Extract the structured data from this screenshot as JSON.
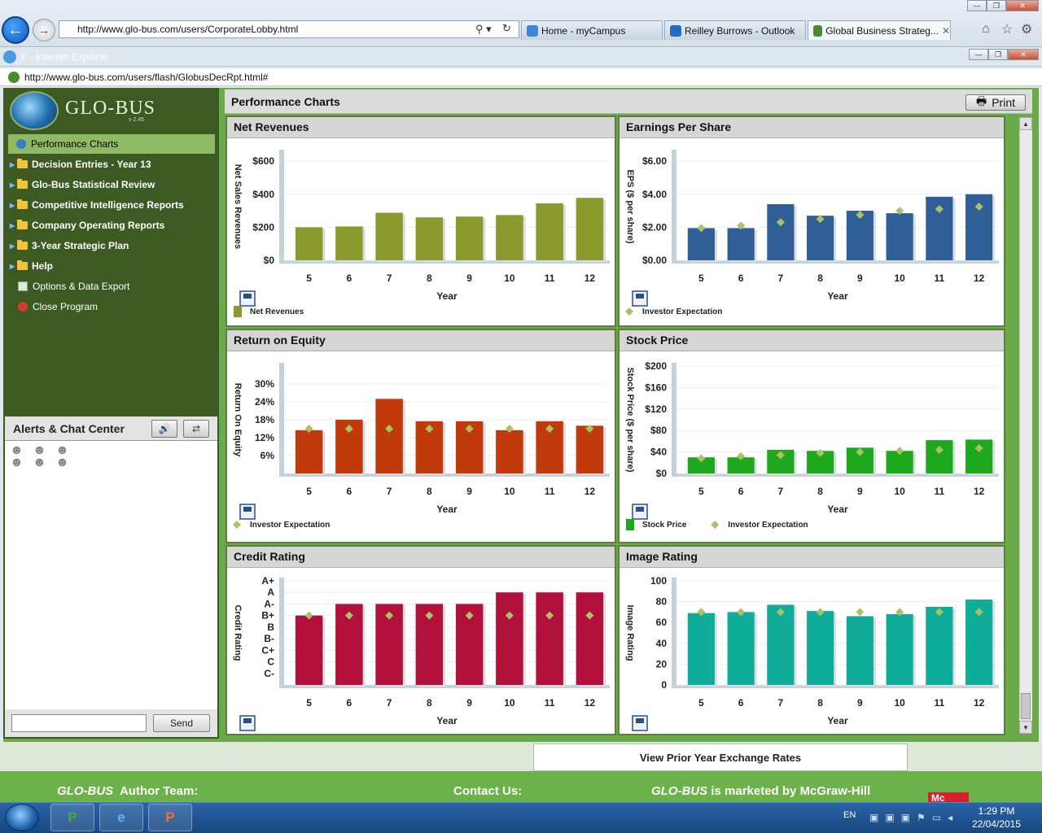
{
  "browser": {
    "address": "http://www.glo-bus.com/users/CorporateLobby.html",
    "tabs": [
      {
        "label": "Home - myCampus"
      },
      {
        "label": "Reilley Burrows - Outlook"
      },
      {
        "label": "Global Business Strateg..."
      }
    ],
    "inner_title": "F - Internet Explorer",
    "inner_address": "http://www.glo-bus.com/users/flash/GlobusDecRpt.html#"
  },
  "app": {
    "logo": "GLO-BUS",
    "version": "v 2.45",
    "menu": [
      {
        "label": "Performance Charts",
        "selected": true
      },
      {
        "label": "Decision Entries - Year 13"
      },
      {
        "label": "Glo-Bus Statistical Review"
      },
      {
        "label": "Competitive Intelligence Reports"
      },
      {
        "label": "Company Operating Reports"
      },
      {
        "label": "3-Year Strategic Plan"
      },
      {
        "label": "Help"
      },
      {
        "label": "Options & Data Export"
      },
      {
        "label": "Close Program"
      }
    ],
    "alerts_title": "Alerts & Chat Center",
    "send_label": "Send",
    "main_title": "Performance Charts",
    "print_label": "Print",
    "x_axis_label": "Year"
  },
  "chart_data": [
    {
      "type": "bar",
      "title": "Net Revenues",
      "ylabel": "Net Sales Revenues",
      "categories": [
        "5",
        "6",
        "7",
        "8",
        "9",
        "10",
        "11",
        "12"
      ],
      "series": [
        {
          "name": "Net Revenues",
          "values": [
            200,
            205,
            288,
            260,
            265,
            274,
            345,
            378
          ]
        }
      ],
      "ylim": [
        0,
        650
      ],
      "yticks": [
        "$0",
        "$200",
        "$400",
        "$600"
      ],
      "ytick_values": [
        0,
        200,
        400,
        600
      ],
      "color": "#8a9a2c"
    },
    {
      "type": "bar",
      "title": "Earnings Per Share",
      "ylabel": "EPS ($ per share)",
      "categories": [
        "5",
        "6",
        "7",
        "8",
        "9",
        "10",
        "11",
        "12"
      ],
      "series": [
        {
          "values": [
            1.95,
            1.95,
            3.4,
            2.7,
            3.0,
            2.85,
            3.85,
            4.0
          ]
        },
        {
          "name": "Investor Expectation",
          "values": [
            1.95,
            2.1,
            2.3,
            2.5,
            2.75,
            3.0,
            3.1,
            3.25
          ]
        }
      ],
      "ylim": [
        0,
        6.5
      ],
      "yticks": [
        "$0.00",
        "$2.00",
        "$4.00",
        "$6.00"
      ],
      "ytick_values": [
        0,
        2,
        4,
        6
      ],
      "color": "#2f5f96"
    },
    {
      "type": "bar",
      "title": "Return on Equity",
      "ylabel": "Return On Equity",
      "categories": [
        "5",
        "6",
        "7",
        "8",
        "9",
        "10",
        "11",
        "12"
      ],
      "series": [
        {
          "values": [
            14.5,
            18,
            25,
            17.5,
            17.5,
            14.5,
            17.5,
            16
          ]
        },
        {
          "name": "Investor Expectation",
          "values": [
            15,
            15,
            15,
            15,
            15,
            15,
            15,
            15
          ]
        }
      ],
      "ylim": [
        0,
        36
      ],
      "yticks": [
        "6%",
        "12%",
        "18%",
        "24%",
        "30%"
      ],
      "ytick_values": [
        6,
        12,
        18,
        24,
        30
      ],
      "color": "#c03a0c"
    },
    {
      "type": "bar",
      "title": "Stock Price",
      "ylabel": "Stock Price ($ per share)",
      "categories": [
        "5",
        "6",
        "7",
        "8",
        "9",
        "10",
        "11",
        "12"
      ],
      "series": [
        {
          "name": "Stock Price",
          "values": [
            30,
            30,
            44,
            42,
            48,
            42,
            62,
            63
          ]
        },
        {
          "name": "Investor Expectation",
          "values": [
            28,
            32,
            34,
            38,
            40,
            42,
            44,
            47
          ]
        }
      ],
      "ylim": [
        0,
        200
      ],
      "yticks": [
        "$0",
        "$40",
        "$80",
        "$120",
        "$160",
        "$200"
      ],
      "ytick_values": [
        0,
        40,
        80,
        120,
        160,
        200
      ],
      "color": "#1ea81e"
    },
    {
      "type": "bar",
      "title": "Credit Rating",
      "ylabel": "Credit Rating",
      "categories": [
        "5",
        "6",
        "7",
        "8",
        "9",
        "10",
        "11",
        "12"
      ],
      "series": [
        {
          "values": [
            6,
            7,
            7,
            7,
            7,
            8,
            8,
            8
          ]
        },
        {
          "name": "Investor Expectation",
          "values": [
            6,
            6,
            6,
            6,
            6,
            6,
            6,
            6
          ]
        }
      ],
      "ylim": [
        0,
        9
      ],
      "yticks": [
        "C-",
        "C",
        "C+",
        "B-",
        "B",
        "B+",
        "A-",
        "A",
        "A+"
      ],
      "ytick_values": [
        1,
        2,
        3,
        4,
        5,
        6,
        7,
        8,
        9
      ],
      "color": "#b0103a"
    },
    {
      "type": "bar",
      "title": "Image Rating",
      "ylabel": "Image Rating",
      "categories": [
        "5",
        "6",
        "7",
        "8",
        "9",
        "10",
        "11",
        "12"
      ],
      "series": [
        {
          "values": [
            69,
            70,
            77,
            71,
            66,
            68,
            75,
            82
          ]
        },
        {
          "name": "Investor Expectation",
          "values": [
            70,
            70,
            70,
            70,
            70,
            70,
            70,
            70
          ]
        }
      ],
      "ylim": [
        0,
        100
      ],
      "yticks": [
        "0",
        "20",
        "40",
        "60",
        "80",
        "100"
      ],
      "ytick_values": [
        0,
        20,
        40,
        60,
        80,
        100
      ],
      "color": "#10ac9a"
    }
  ],
  "bottom": {
    "prior_rates": "View Prior Year Exchange Rates",
    "footer_author": "Author Team:",
    "footer_contact": "Contact Us:",
    "footer_market": "is marketed by McGraw-Hill",
    "footer_brand": "GLO-BUS",
    "mc": "Mc"
  },
  "taskbar": {
    "lang": "EN",
    "time": "1:29 PM",
    "date": "22/04/2015"
  }
}
